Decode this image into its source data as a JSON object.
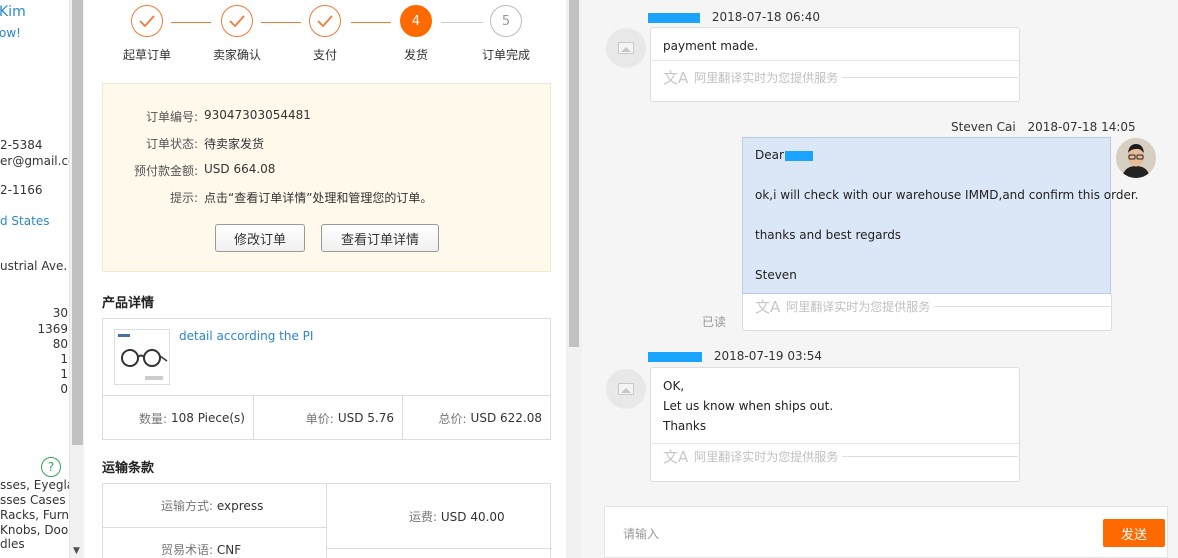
{
  "left_panel": {
    "name_fragment": "Kim",
    "status_fragment": "ow!",
    "phone1": "2-5384",
    "email": "er@gmail.co",
    "phone2": "2-1166",
    "country": "d States",
    "address": "ustrial Ave.",
    "numbers": [
      "30",
      "1369",
      "80",
      "1",
      "1",
      "0"
    ],
    "help_icon": "?",
    "categories": [
      "sses, Eyeglas",
      "sses Cases &",
      "Racks, Furnit",
      "Knobs, Door",
      "dles"
    ]
  },
  "stepper": {
    "steps": [
      {
        "label": "起草订单",
        "state": "done"
      },
      {
        "label": "卖家确认",
        "state": "done"
      },
      {
        "label": "支付",
        "state": "done"
      },
      {
        "label": "发货",
        "state": "active",
        "num": "4"
      },
      {
        "label": "订单完成",
        "state": "future",
        "num": "5"
      }
    ]
  },
  "order_info": {
    "order_no_label": "订单编号:",
    "order_no": "93047303054481",
    "status_label": "订单状态:",
    "status": "待卖家发货",
    "prepay_label": "预付款金额:",
    "prepay": "USD 664.08",
    "tip_label": "提示:",
    "tip": "点击“查看订单详情”处理和管理您的订单。",
    "modify_button": "修改订单",
    "view_button": "查看订单详情"
  },
  "product": {
    "section_title": "产品详情",
    "link_text": "detail according the PI",
    "qty_label": "数量:",
    "qty": "108 Piece(s)",
    "unit_label": "单价:",
    "unit": "USD 5.76",
    "total_label": "总价:",
    "total": "USD 622.08"
  },
  "shipping": {
    "section_title": "运输条款",
    "method_label": "运输方式:",
    "method": "express",
    "fee_label": "运费:",
    "fee": "USD 40.00",
    "term_label": "贸易术语:",
    "term": "CNF"
  },
  "chat": {
    "translate_text": "阿里翻译实时为您提供服务",
    "read_label": "已读",
    "messages": [
      {
        "time": "2018-07-18 06:40",
        "lines": [
          "payment made."
        ]
      },
      {
        "sender": "Steven Cai",
        "time": "2018-07-18 14:05",
        "greeting": "Dear",
        "lines": [
          "ok,i will check with our warehouse IMMD,and confirm this order.",
          "thanks and best regards",
          "Steven"
        ]
      },
      {
        "time": "2018-07-19 03:54",
        "lines": [
          "OK,",
          "Let us know when ships out.",
          "Thanks"
        ]
      }
    ],
    "input_placeholder": "请输入",
    "send_label": "发送"
  },
  "colors": {
    "accent": "#ff6a00",
    "link": "#2c86c9",
    "bubble_blue": "#dbe6f6",
    "redaction": "#1aa3ff"
  }
}
